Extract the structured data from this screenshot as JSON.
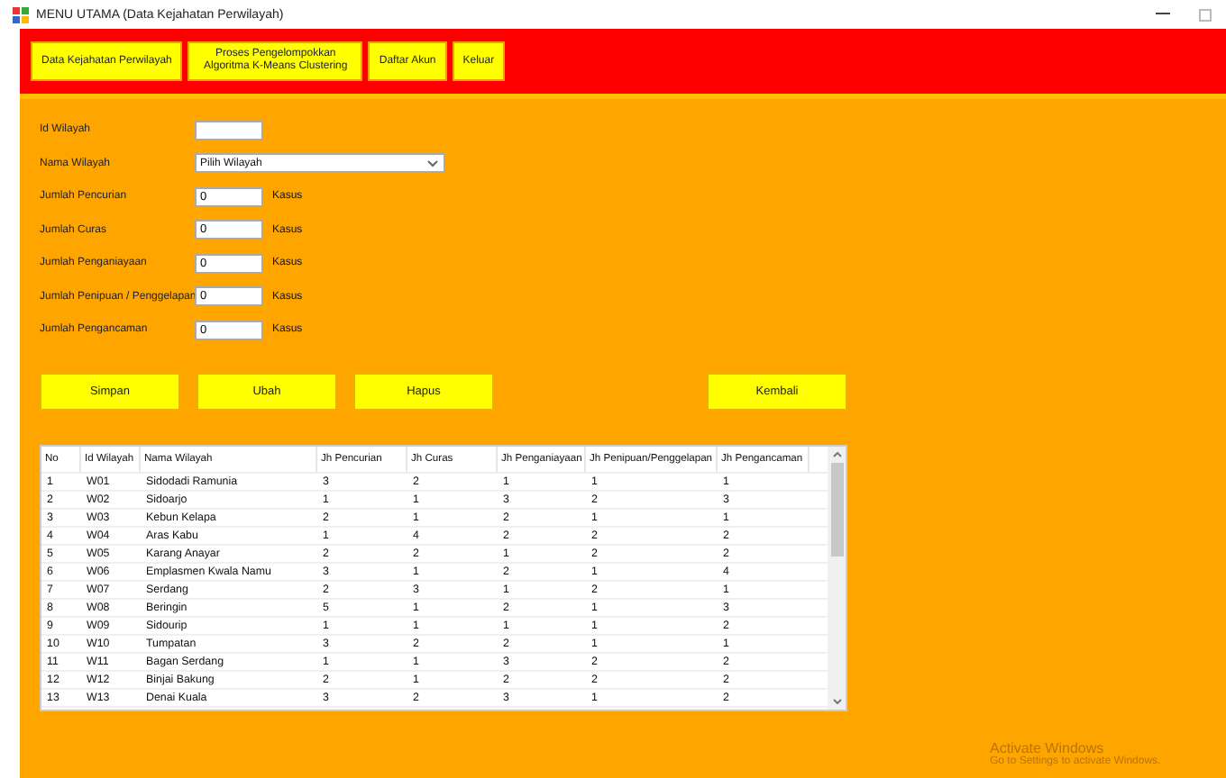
{
  "window": {
    "title": "MENU UTAMA (Data Kejahatan Perwilayah)"
  },
  "menu": [
    "Data Kejahatan Perwilayah",
    "Proses Pengelompokkan Algoritma K-Means Clustering",
    "Daftar Akun",
    "Keluar"
  ],
  "form": [
    {
      "kind": "text",
      "label": "Id Wilayah"
    },
    {
      "kind": "select",
      "label": "Nama Wilayah",
      "value": "Pilih Wilayah"
    },
    {
      "kind": "text",
      "label": "Jumlah Pencurian",
      "value": "0",
      "unit": "Kasus"
    },
    {
      "kind": "text",
      "label": "Jumlah Curas",
      "value": "0",
      "unit": "Kasus"
    },
    {
      "kind": "text",
      "label": "Jumlah Penganiayaan",
      "value": "0",
      "unit": "Kasus"
    },
    {
      "kind": "text",
      "label": "Jumlah Penipuan / Penggelapan",
      "value": "0",
      "unit": "Kasus"
    },
    {
      "kind": "text",
      "label": "Jumlah Pengancaman",
      "value": "0",
      "unit": "Kasus"
    }
  ],
  "actions": [
    "Simpan",
    "Ubah",
    "Hapus"
  ],
  "back_button": "Kembali",
  "table": {
    "columns": [
      "No",
      "Id Wilayah",
      "Nama Wilayah",
      "Jh Pencurian",
      "Jh Curas",
      "Jh Penganiayaan",
      "Jh Penipuan/Penggelapan",
      "Jh Pengancaman"
    ],
    "rows": [
      [
        "1",
        "W01",
        "Sidodadi Ramunia",
        "3",
        "2",
        "1",
        "1",
        "1"
      ],
      [
        "2",
        "W02",
        "Sidoarjo",
        "1",
        "1",
        "3",
        "2",
        "3"
      ],
      [
        "3",
        "W03",
        "Kebun Kelapa",
        "2",
        "1",
        "2",
        "1",
        "1"
      ],
      [
        "4",
        "W04",
        "Aras Kabu",
        "1",
        "4",
        "2",
        "2",
        "2"
      ],
      [
        "5",
        "W05",
        "Karang Anayar",
        "2",
        "2",
        "1",
        "2",
        "2"
      ],
      [
        "6",
        "W06",
        "Emplasmen Kwala Namu",
        "3",
        "1",
        "2",
        "1",
        "4"
      ],
      [
        "7",
        "W07",
        "Serdang",
        "2",
        "3",
        "1",
        "2",
        "1"
      ],
      [
        "8",
        "W08",
        "Beringin",
        "5",
        "1",
        "2",
        "1",
        "3"
      ],
      [
        "9",
        "W09",
        "Sidourip",
        "1",
        "1",
        "1",
        "1",
        "2"
      ],
      [
        "10",
        "W10",
        "Tumpatan",
        "3",
        "2",
        "2",
        "1",
        "1"
      ],
      [
        "11",
        "W11",
        "Bagan Serdang",
        "1",
        "1",
        "3",
        "2",
        "2"
      ],
      [
        "12",
        "W12",
        "Binjai Bakung",
        "2",
        "1",
        "2",
        "2",
        "2"
      ],
      [
        "13",
        "W13",
        "Denai Kuala",
        "3",
        "2",
        "3",
        "1",
        "2"
      ]
    ]
  },
  "os_notice": {
    "title": "Activate Windows",
    "text": "Go to Settings to activate Windows."
  }
}
